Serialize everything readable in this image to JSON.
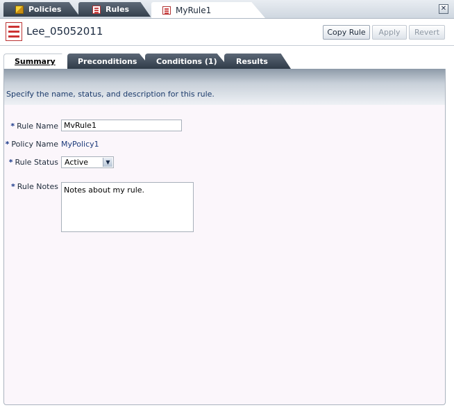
{
  "top_tabs": [
    {
      "label": "Policies",
      "icon": "policies-icon",
      "active": false
    },
    {
      "label": "Rules",
      "icon": "rules-icon",
      "active": false
    },
    {
      "label": "MyRule1",
      "icon": "rule-document-icon",
      "active": true
    }
  ],
  "header": {
    "title": "Lee_05052011",
    "icon": "rule-checklist-icon",
    "buttons": {
      "copy_rule": "Copy Rule",
      "apply": "Apply",
      "revert": "Revert"
    }
  },
  "inner_tabs": [
    {
      "label": "Summary",
      "active": true
    },
    {
      "label": "Preconditions",
      "active": false
    },
    {
      "label": "Conditions (1)",
      "active": false
    },
    {
      "label": "Results",
      "active": false
    }
  ],
  "summary": {
    "description": "Specify the name, status, and description for this rule.",
    "required_marker": "*",
    "rule_name": {
      "label": "Rule Name",
      "value": "MvRule1"
    },
    "policy_name": {
      "label": "Policy Name",
      "value": "MyPolicy1"
    },
    "rule_status": {
      "label": "Rule Status",
      "value": "Active"
    },
    "rule_notes": {
      "label": "Rule Notes",
      "value": "Notes about my rule."
    }
  },
  "colors": {
    "accent_blue": "#1c3a7a",
    "tab_dark": "#34404d",
    "rule_icon_red": "#cc3333"
  }
}
